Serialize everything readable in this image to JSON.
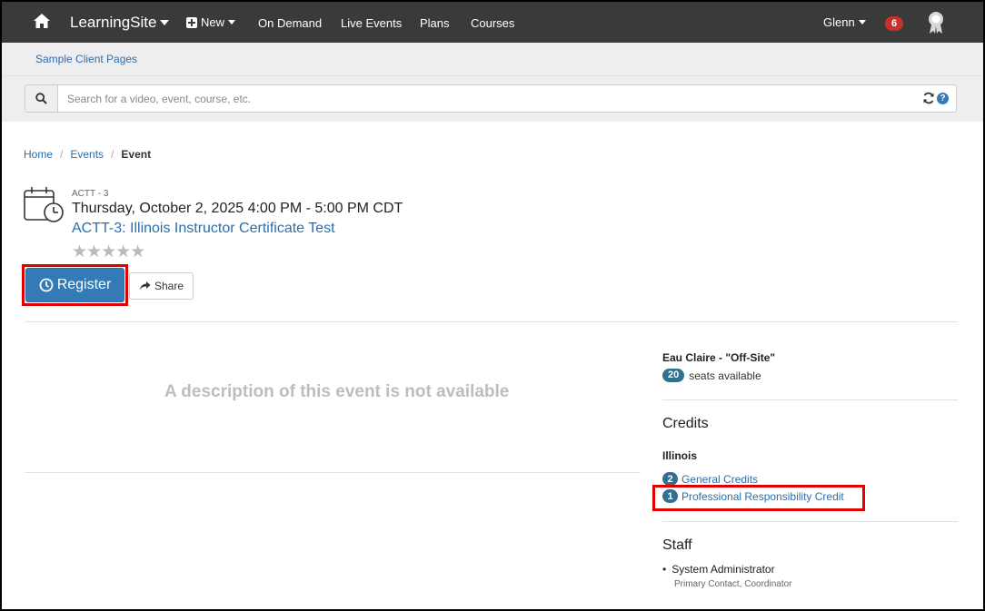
{
  "navbar": {
    "brand": "LearningSite",
    "new_label": "New",
    "links": [
      "On Demand",
      "Live Events",
      "Plans",
      "Courses"
    ],
    "user": "Glenn",
    "notification_count": "6"
  },
  "subheader": {
    "link": "Sample Client Pages"
  },
  "search": {
    "placeholder": "Search for a video, event, course, etc.",
    "help": "?"
  },
  "breadcrumb": {
    "items": [
      "Home",
      "Events"
    ],
    "current": "Event",
    "separator": "/"
  },
  "event": {
    "code": "ACTT - 3",
    "datetime": "Thursday, October 2, 2025 4:00 PM - 5:00 PM CDT",
    "title": "ACTT-3: Illinois Instructor Certificate Test",
    "stars": "★★★★★",
    "register_label": "Register",
    "share_label": "Share",
    "no_description": "A description of this event is not available"
  },
  "location": {
    "name": "Eau Claire - \"Off-Site\"",
    "seats_count": "20",
    "seats_label": "seats available"
  },
  "credits": {
    "heading": "Credits",
    "state": "Illinois",
    "items": [
      {
        "count": "2",
        "label": "General Credits"
      },
      {
        "count": "1",
        "label": "Professional Responsibility Credit"
      }
    ]
  },
  "staff": {
    "heading": "Staff",
    "members": [
      {
        "name": "System Administrator",
        "role": "Primary Contact, Coordinator"
      }
    ]
  },
  "colors": {
    "navbar": "#3a3a3a",
    "link": "#2a6eaf",
    "primary_button": "#337ab7",
    "badge": "#31708f",
    "notification": "#c9302c",
    "highlight": "#e00000"
  },
  "icons": [
    "home-icon",
    "plus-square-icon",
    "award-icon",
    "search-icon",
    "refresh-icon",
    "help-icon",
    "calendar-clock-icon",
    "clock-icon",
    "share-icon"
  ]
}
